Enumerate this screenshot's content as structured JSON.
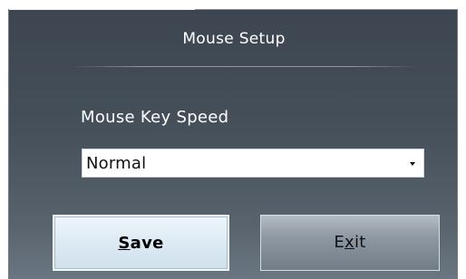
{
  "dialog": {
    "title": "Mouse Setup",
    "field_label": "Mouse Key Speed",
    "speed_select": {
      "value": "Normal"
    },
    "buttons": {
      "save": {
        "mnemonic": "S",
        "rest": "ave"
      },
      "exit": {
        "before": "E",
        "mnemonic": "x",
        "after": "it"
      }
    }
  }
}
